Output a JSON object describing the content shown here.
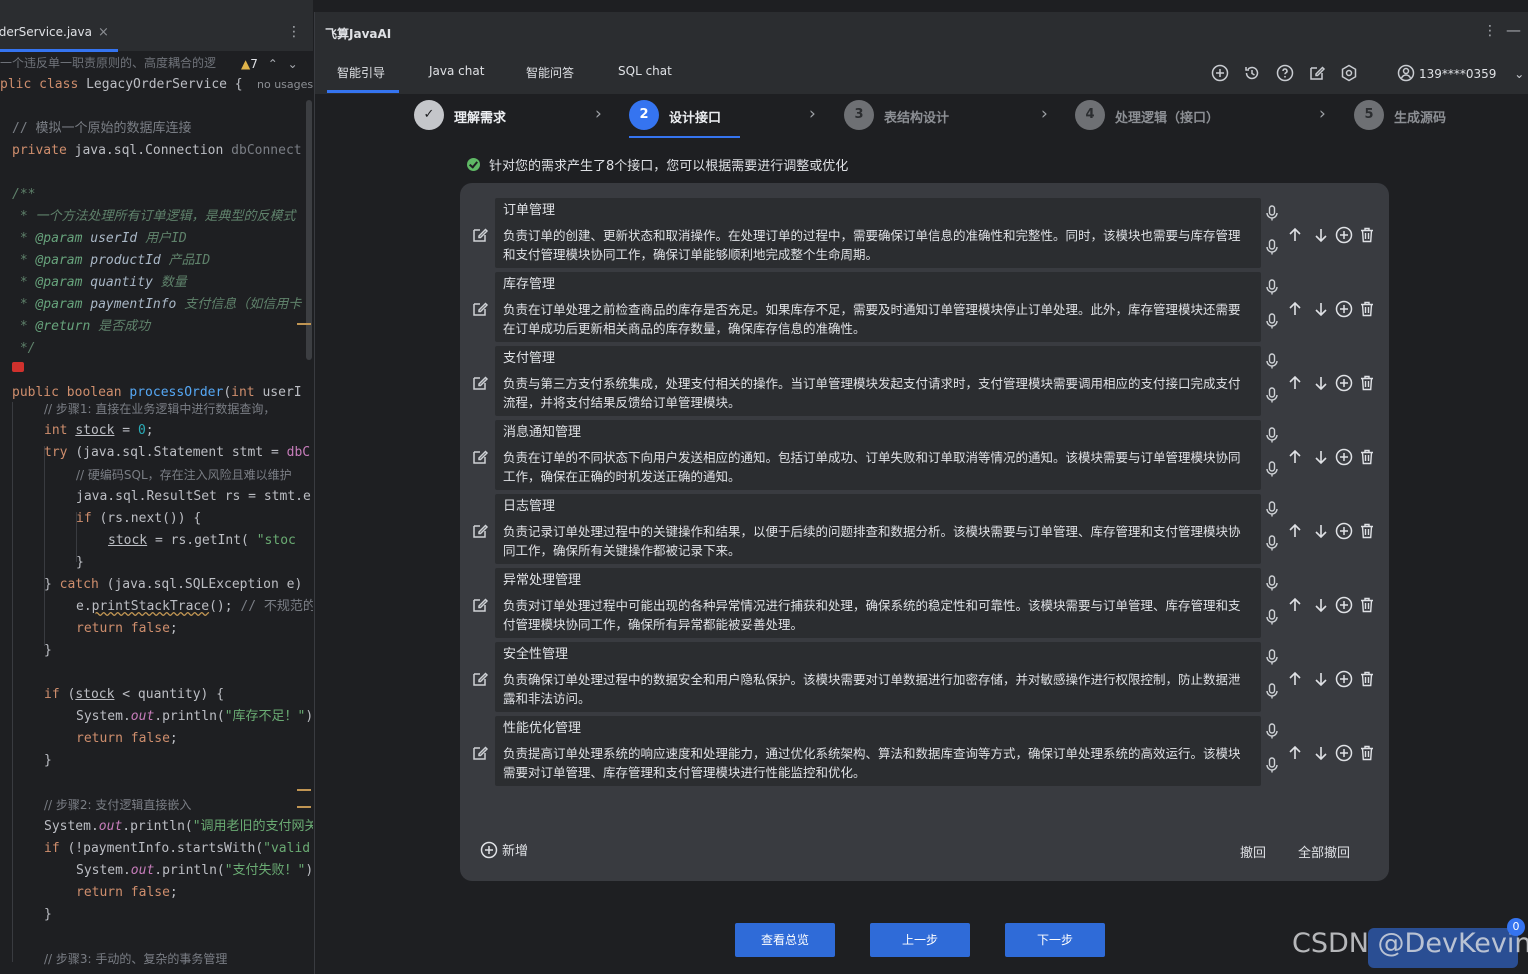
{
  "editor": {
    "tab_label": "rderService.java",
    "warning_count": "7",
    "lines": [
      {
        "t": "一个违反单一职责原则的、高度耦合的逻"
      },
      {
        "t": "plic class LegacyOrderService {"
      },
      {
        "t": "no usages"
      },
      {
        "t": "// 模拟一个原始的数据库连接"
      },
      {
        "t": "private java.sql.Connection dbConnect"
      },
      {
        "t": "/**"
      },
      {
        "t": " * 一个方法处理所有订单逻辑，是典型的反模式"
      },
      {
        "t": " * @param userId 用户ID"
      },
      {
        "t": " * @param productId 产品ID"
      },
      {
        "t": " * @param quantity 数量"
      },
      {
        "t": " * @param paymentInfo 支付信息（如信用卡"
      },
      {
        "t": " * @return 是否成功"
      },
      {
        "t": " */"
      },
      {
        "t": "public boolean processOrder(int userI"
      },
      {
        "t": "// 步骤1: 直接在业务逻辑中进行数据查询，"
      },
      {
        "t": "int stock = 0;"
      },
      {
        "t": "try (java.sql.Statement stmt = dbC"
      },
      {
        "t": "// 硬编码SQL，存在注入风险且难以维护"
      },
      {
        "t": "java.sql.ResultSet rs = stmt.e"
      },
      {
        "t": "if (rs.next()) {"
      },
      {
        "t": "stock = rs.getInt( \"stoc"
      },
      {
        "t": "}"
      },
      {
        "t": "} catch (java.sql.SQLException e)"
      },
      {
        "t": "e.printStackTrace(); // 不规范的"
      },
      {
        "t": "return false;"
      },
      {
        "t": "}"
      },
      {
        "t": "if (stock < quantity) {"
      },
      {
        "t": "System.out.println(\"库存不足！\")"
      },
      {
        "t": "return false;"
      },
      {
        "t": "}"
      },
      {
        "t": "// 步骤2: 支付逻辑直接嵌入"
      },
      {
        "t": "System.out.println(\"调用老旧的支付网关"
      },
      {
        "t": "if (!paymentInfo.startsWith(\"valid"
      },
      {
        "t": "System.out.println(\"支付失败！\")"
      },
      {
        "t": "return false;"
      },
      {
        "t": "}"
      },
      {
        "t": "// 步骤3: 手动的、复杂的事务管理"
      }
    ]
  },
  "panel": {
    "title": "飞算JavaAI",
    "tabs": [
      "智能引导",
      "Java chat",
      "智能问答",
      "SQL chat"
    ],
    "user": "139****0359",
    "steps": [
      {
        "num": "✓",
        "label": "理解需求",
        "state": "done"
      },
      {
        "num": "2",
        "label": "设计接口",
        "state": "active"
      },
      {
        "num": "3",
        "label": "表结构设计",
        "state": "todo"
      },
      {
        "num": "4",
        "label": "处理逻辑（接口）",
        "state": "todo"
      },
      {
        "num": "5",
        "label": "生成源码",
        "state": "todo"
      }
    ],
    "notice": "针对您的需求产生了8个接口，您可以根据需要进行调整或优化",
    "items": [
      {
        "title": "订单管理",
        "desc": "负责订单的创建、更新状态和取消操作。在处理订单的过程中，需要确保订单信息的准确性和完整性。同时，该模块也需要与库存管理和支付管理模块协同工作，确保订单能够顺利地完成整个生命周期。"
      },
      {
        "title": "库存管理",
        "desc": "负责在订单处理之前检查商品的库存是否充足。如果库存不足，需要及时通知订单管理模块停止订单处理。此外，库存管理模块还需要在订单成功后更新相关商品的库存数量，确保库存信息的准确性。"
      },
      {
        "title": "支付管理",
        "desc": "负责与第三方支付系统集成，处理支付相关的操作。当订单管理模块发起支付请求时，支付管理模块需要调用相应的支付接口完成支付流程，并将支付结果反馈给订单管理模块。"
      },
      {
        "title": "消息通知管理",
        "desc": "负责在订单的不同状态下向用户发送相应的通知。包括订单成功、订单失败和订单取消等情况的通知。该模块需要与订单管理模块协同工作，确保在正确的时机发送正确的通知。"
      },
      {
        "title": "日志管理",
        "desc": "负责记录订单处理过程中的关键操作和结果，以便于后续的问题排查和数据分析。该模块需要与订单管理、库存管理和支付管理模块协同工作，确保所有关键操作都被记录下来。"
      },
      {
        "title": "异常处理管理",
        "desc": "负责对订单处理过程中可能出现的各种异常情况进行捕获和处理，确保系统的稳定性和可靠性。该模块需要与订单管理、库存管理和支付管理模块协同工作，确保所有异常都能被妥善处理。"
      },
      {
        "title": "安全性管理",
        "desc": "负责确保订单处理过程中的数据安全和用户隐私保护。该模块需要对订单数据进行加密存储，并对敏感操作进行权限控制，防止数据泄露和非法访问。"
      },
      {
        "title": "性能优化管理",
        "desc": "负责提高订单处理系统的响应速度和处理能力，通过优化系统架构、算法和数据库查询等方式，确保订单处理系统的高效运行。该模块需要对订单管理、库存管理和支付管理模块进行性能监控和优化。"
      }
    ],
    "add_label": "新增",
    "undo_label": "撤回",
    "undo_all_label": "全部撤回",
    "buttons": {
      "overview": "查看总览",
      "prev": "上一步",
      "next": "下一步"
    },
    "colors": {
      "accent": "#3574f0",
      "button": "#2f6bd8",
      "card": "#393b40",
      "item": "#2b2d30"
    }
  },
  "watermark": {
    "text": "CSDN @DevKevin",
    "badge": "0"
  }
}
